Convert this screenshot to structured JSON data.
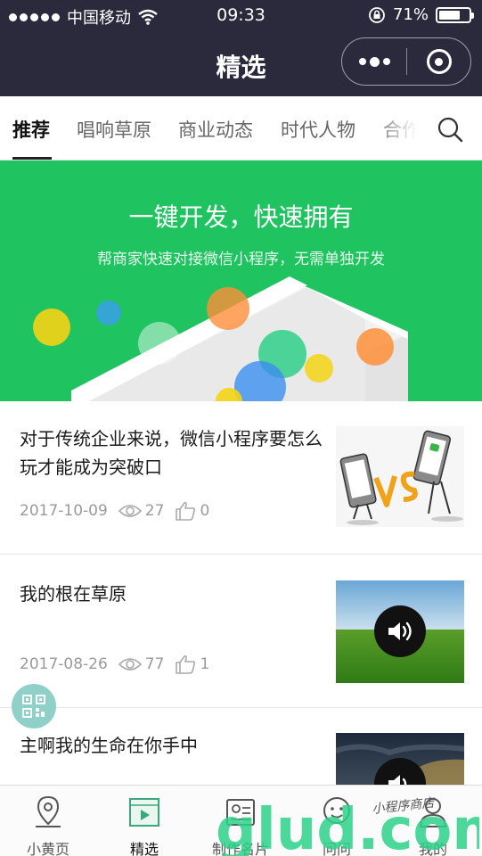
{
  "status_bar": {
    "carrier": "中国移动",
    "time": "09:33",
    "battery_text": "71%",
    "battery_level": 0.71
  },
  "nav": {
    "title": "精选",
    "more_icon": "more-dots-icon",
    "close_icon": "close-circle-icon"
  },
  "tabs": {
    "items": [
      {
        "label": "推荐",
        "active": true
      },
      {
        "label": "唱响草原"
      },
      {
        "label": "商业动态"
      },
      {
        "label": "时代人物"
      },
      {
        "label": "合作"
      }
    ],
    "search_icon": "search-icon"
  },
  "banner": {
    "title": "一键开发，快速拥有",
    "subtitle": "帮商家快速对接微信小程序，无需单独开发"
  },
  "articles": [
    {
      "title": "对于传统企业来说，微信小程序要怎么玩才能成为突破口",
      "date": "2017-10-09",
      "views": "27",
      "likes": "0",
      "thumb": "cartoon-vs-phones-image"
    },
    {
      "title": "我的根在草原",
      "date": "2017-08-26",
      "views": "77",
      "likes": "1",
      "thumb": "grassland-image-with-audio"
    },
    {
      "title": "主啊我的生命在你手中",
      "thumb": "dark-sky-image-with-audio"
    }
  ],
  "tabbar": {
    "items": [
      {
        "label": "小黄页",
        "icon": "location-pin-icon"
      },
      {
        "label": "精选",
        "icon": "video-play-icon",
        "active": true
      },
      {
        "label": "制作名片",
        "icon": "card-icon"
      },
      {
        "label": "问问",
        "icon": "chat-face-icon"
      },
      {
        "label": "我的",
        "icon": "user-icon"
      }
    ]
  },
  "watermark": {
    "main": "glud.com",
    "small": "小程序商店"
  },
  "colors": {
    "header_bg": "#2b2a3d",
    "banner_green": "#1fc35f",
    "qr_float": "#8fd0c8"
  }
}
